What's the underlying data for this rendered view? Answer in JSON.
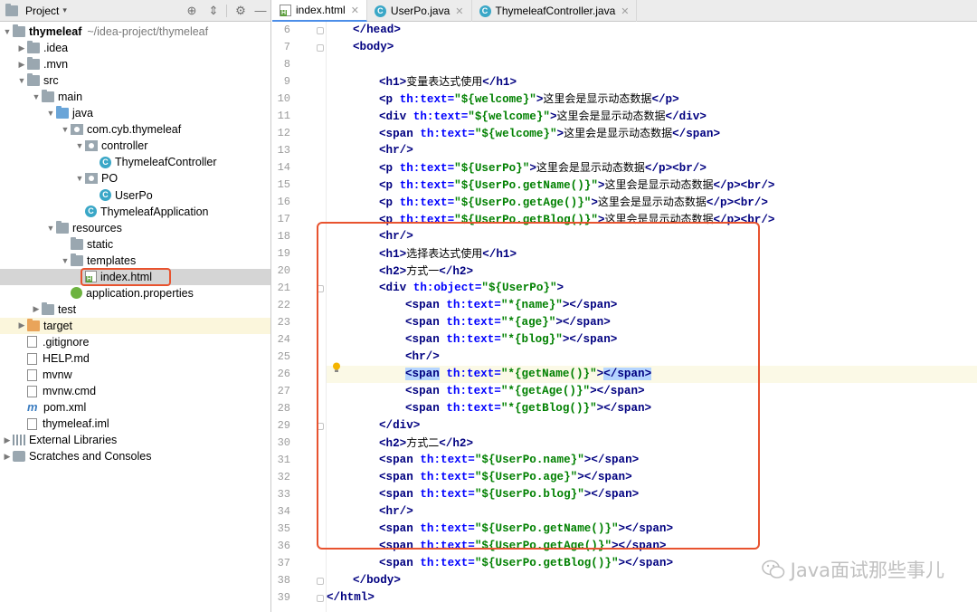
{
  "project_panel": {
    "title": "Project",
    "tree": [
      {
        "label": "thymeleaf",
        "path": "~/idea-project/thymeleaf",
        "indent": 0,
        "arrow": "down",
        "icon": "folder-icon",
        "bold": true
      },
      {
        "label": ".idea",
        "indent": 1,
        "arrow": "right",
        "icon": "folder-icon"
      },
      {
        "label": ".mvn",
        "indent": 1,
        "arrow": "right",
        "icon": "folder-icon"
      },
      {
        "label": "src",
        "indent": 1,
        "arrow": "down",
        "icon": "folder-icon"
      },
      {
        "label": "main",
        "indent": 2,
        "arrow": "down",
        "icon": "folder-icon"
      },
      {
        "label": "java",
        "indent": 3,
        "arrow": "down",
        "icon": "source-folder-icon"
      },
      {
        "label": "com.cyb.thymeleaf",
        "indent": 4,
        "arrow": "down",
        "icon": "package-icon"
      },
      {
        "label": "controller",
        "indent": 5,
        "arrow": "down",
        "icon": "package-icon"
      },
      {
        "label": "ThymeleafController",
        "indent": 6,
        "arrow": "",
        "icon": "class-icon"
      },
      {
        "label": "PO",
        "indent": 5,
        "arrow": "down",
        "icon": "package-icon"
      },
      {
        "label": "UserPo",
        "indent": 6,
        "arrow": "",
        "icon": "class-icon"
      },
      {
        "label": "ThymeleafApplication",
        "indent": 5,
        "arrow": "",
        "icon": "spring-class-icon"
      },
      {
        "label": "resources",
        "indent": 3,
        "arrow": "down",
        "icon": "resources-folder-icon"
      },
      {
        "label": "static",
        "indent": 4,
        "arrow": "",
        "icon": "folder-icon"
      },
      {
        "label": "templates",
        "indent": 4,
        "arrow": "down",
        "icon": "folder-icon"
      },
      {
        "label": "index.html",
        "indent": 5,
        "arrow": "",
        "icon": "html-file-icon",
        "selected": true
      },
      {
        "label": "application.properties",
        "indent": 4,
        "arrow": "",
        "icon": "properties-file-icon"
      },
      {
        "label": "test",
        "indent": 2,
        "arrow": "right",
        "icon": "folder-icon"
      },
      {
        "label": "target",
        "indent": 1,
        "arrow": "right",
        "icon": "excluded-folder-icon",
        "highlight": true
      },
      {
        "label": ".gitignore",
        "indent": 1,
        "arrow": "",
        "icon": "gitignore-file-icon"
      },
      {
        "label": "HELP.md",
        "indent": 1,
        "arrow": "",
        "icon": "markdown-file-icon"
      },
      {
        "label": "mvnw",
        "indent": 1,
        "arrow": "",
        "icon": "script-file-icon"
      },
      {
        "label": "mvnw.cmd",
        "indent": 1,
        "arrow": "",
        "icon": "text-file-icon"
      },
      {
        "label": "pom.xml",
        "indent": 1,
        "arrow": "",
        "icon": "maven-icon"
      },
      {
        "label": "thymeleaf.iml",
        "indent": 1,
        "arrow": "",
        "icon": "iml-file-icon"
      },
      {
        "label": "External Libraries",
        "indent": 0,
        "arrow": "right",
        "icon": "libraries-icon"
      },
      {
        "label": "Scratches and Consoles",
        "indent": 0,
        "arrow": "right",
        "icon": "scratches-icon"
      }
    ]
  },
  "editor": {
    "tabs": [
      {
        "label": "index.html",
        "icon": "html-file-icon",
        "active": true
      },
      {
        "label": "UserPo.java",
        "icon": "class-icon",
        "active": false
      },
      {
        "label": "ThymeleafController.java",
        "icon": "class-icon",
        "active": false
      }
    ],
    "current_line": 26,
    "lines": [
      {
        "n": "6",
        "indent": 1,
        "tokens": [
          [
            "tag",
            "</head>"
          ]
        ]
      },
      {
        "n": "7",
        "indent": 1,
        "tokens": [
          [
            "tag",
            "<body>"
          ]
        ]
      },
      {
        "n": "8",
        "indent": 0,
        "tokens": []
      },
      {
        "n": "9",
        "indent": 2,
        "tokens": [
          [
            "tag",
            "<h1>"
          ],
          [
            "cn",
            "变量表达式使用"
          ],
          [
            "tag",
            "</h1>"
          ]
        ]
      },
      {
        "n": "10",
        "indent": 2,
        "tokens": [
          [
            "tag",
            "<p "
          ],
          [
            "attr",
            "th:text="
          ],
          [
            "str",
            "\""
          ],
          [
            "strx",
            "${welcome}"
          ],
          [
            "str",
            "\""
          ],
          [
            "tag",
            ">"
          ],
          [
            "cn",
            "这里会是显示动态数据"
          ],
          [
            "tag",
            "</p>"
          ]
        ]
      },
      {
        "n": "11",
        "indent": 2,
        "tokens": [
          [
            "tag",
            "<div "
          ],
          [
            "attr",
            "th:text="
          ],
          [
            "str",
            "\""
          ],
          [
            "strx",
            "${welcome}"
          ],
          [
            "str",
            "\""
          ],
          [
            "tag",
            ">"
          ],
          [
            "cn",
            "这里会是显示动态数据"
          ],
          [
            "tag",
            "</div>"
          ]
        ]
      },
      {
        "n": "12",
        "indent": 2,
        "tokens": [
          [
            "tag",
            "<span "
          ],
          [
            "attr",
            "th:text="
          ],
          [
            "str",
            "\""
          ],
          [
            "strx",
            "${welcome}"
          ],
          [
            "str",
            "\""
          ],
          [
            "tag",
            ">"
          ],
          [
            "cn",
            "这里会是显示动态数据"
          ],
          [
            "tag",
            "</span>"
          ]
        ]
      },
      {
        "n": "13",
        "indent": 2,
        "tokens": [
          [
            "tag",
            "<hr/>"
          ]
        ]
      },
      {
        "n": "14",
        "indent": 2,
        "tokens": [
          [
            "tag",
            "<p "
          ],
          [
            "attr",
            "th:text="
          ],
          [
            "str",
            "\""
          ],
          [
            "strx",
            "${UserPo}"
          ],
          [
            "str",
            "\""
          ],
          [
            "tag",
            ">"
          ],
          [
            "cn",
            "这里会是显示动态数据"
          ],
          [
            "tag",
            "</p><br/>"
          ]
        ]
      },
      {
        "n": "15",
        "indent": 2,
        "tokens": [
          [
            "tag",
            "<p "
          ],
          [
            "attr",
            "th:text="
          ],
          [
            "str",
            "\""
          ],
          [
            "strx",
            "${UserPo.getName()}"
          ],
          [
            "str",
            "\""
          ],
          [
            "tag",
            ">"
          ],
          [
            "cn",
            "这里会是显示动态数据"
          ],
          [
            "tag",
            "</p><br/>"
          ]
        ]
      },
      {
        "n": "16",
        "indent": 2,
        "tokens": [
          [
            "tag",
            "<p "
          ],
          [
            "attr",
            "th:text="
          ],
          [
            "str",
            "\""
          ],
          [
            "strx",
            "${UserPo.getAge()}"
          ],
          [
            "str",
            "\""
          ],
          [
            "tag",
            ">"
          ],
          [
            "cn",
            "这里会是显示动态数据"
          ],
          [
            "tag",
            "</p><br/>"
          ]
        ]
      },
      {
        "n": "17",
        "indent": 2,
        "tokens": [
          [
            "tag",
            "<p "
          ],
          [
            "attr",
            "th:text="
          ],
          [
            "str",
            "\""
          ],
          [
            "strx",
            "${UserPo.getBlog()}"
          ],
          [
            "str",
            "\""
          ],
          [
            "tag",
            ">"
          ],
          [
            "cn",
            "这里会是显示动态数据"
          ],
          [
            "tag",
            "</p><br/>"
          ]
        ]
      },
      {
        "n": "18",
        "indent": 2,
        "tokens": [
          [
            "tag",
            "<hr/>"
          ]
        ]
      },
      {
        "n": "19",
        "indent": 2,
        "tokens": [
          [
            "tag",
            "<h1>"
          ],
          [
            "cn",
            "选择表达式使用"
          ],
          [
            "tag",
            "</h1>"
          ]
        ]
      },
      {
        "n": "20",
        "indent": 2,
        "tokens": [
          [
            "tag",
            "<h2>"
          ],
          [
            "cn",
            "方式一"
          ],
          [
            "tag",
            "</h2>"
          ]
        ]
      },
      {
        "n": "21",
        "indent": 2,
        "tokens": [
          [
            "tag",
            "<div "
          ],
          [
            "attr",
            "th:object="
          ],
          [
            "str",
            "\""
          ],
          [
            "strx",
            "${UserPo}"
          ],
          [
            "str",
            "\""
          ],
          [
            "tag",
            ">"
          ]
        ]
      },
      {
        "n": "22",
        "indent": 3,
        "tokens": [
          [
            "tag",
            "<span "
          ],
          [
            "attr",
            "th:text="
          ],
          [
            "str",
            "\""
          ],
          [
            "strx",
            "*{name}"
          ],
          [
            "str",
            "\""
          ],
          [
            "tag",
            "></span>"
          ]
        ]
      },
      {
        "n": "23",
        "indent": 3,
        "tokens": [
          [
            "tag",
            "<span "
          ],
          [
            "attr",
            "th:text="
          ],
          [
            "str",
            "\""
          ],
          [
            "strx",
            "*{age}"
          ],
          [
            "str",
            "\""
          ],
          [
            "tag",
            "></span>"
          ]
        ]
      },
      {
        "n": "24",
        "indent": 3,
        "tokens": [
          [
            "tag",
            "<span "
          ],
          [
            "attr",
            "th:text="
          ],
          [
            "str",
            "\""
          ],
          [
            "strx",
            "*{blog}"
          ],
          [
            "str",
            "\""
          ],
          [
            "tag",
            "></span>"
          ]
        ]
      },
      {
        "n": "25",
        "indent": 3,
        "tokens": [
          [
            "tag",
            "<hr/>"
          ]
        ]
      },
      {
        "n": "26",
        "indent": 3,
        "tokens": [
          [
            "taghl",
            "<span"
          ],
          [
            "tag",
            " "
          ],
          [
            "attr",
            "th:text="
          ],
          [
            "str",
            "\""
          ],
          [
            "strx",
            "*{getName()}"
          ],
          [
            "str",
            "\""
          ],
          [
            "tag",
            ">"
          ],
          [
            "taghl",
            "</span>"
          ]
        ]
      },
      {
        "n": "27",
        "indent": 3,
        "tokens": [
          [
            "tag",
            "<span "
          ],
          [
            "attr",
            "th:text="
          ],
          [
            "str",
            "\""
          ],
          [
            "strx",
            "*{getAge()}"
          ],
          [
            "str",
            "\""
          ],
          [
            "tag",
            "></span>"
          ]
        ]
      },
      {
        "n": "28",
        "indent": 3,
        "tokens": [
          [
            "tag",
            "<span "
          ],
          [
            "attr",
            "th:text="
          ],
          [
            "str",
            "\""
          ],
          [
            "strx",
            "*{getBlog()}"
          ],
          [
            "str",
            "\""
          ],
          [
            "tag",
            "></span>"
          ]
        ]
      },
      {
        "n": "29",
        "indent": 2,
        "tokens": [
          [
            "tag",
            "</div>"
          ]
        ]
      },
      {
        "n": "30",
        "indent": 2,
        "tokens": [
          [
            "tag",
            "<h2>"
          ],
          [
            "cn",
            "方式二"
          ],
          [
            "tag",
            "</h2>"
          ]
        ]
      },
      {
        "n": "31",
        "indent": 2,
        "tokens": [
          [
            "tag",
            "<span "
          ],
          [
            "attr",
            "th:text="
          ],
          [
            "str",
            "\""
          ],
          [
            "strx",
            "${UserPo.name}"
          ],
          [
            "str",
            "\""
          ],
          [
            "tag",
            "></span>"
          ]
        ]
      },
      {
        "n": "32",
        "indent": 2,
        "tokens": [
          [
            "tag",
            "<span "
          ],
          [
            "attr",
            "th:text="
          ],
          [
            "str",
            "\""
          ],
          [
            "strx",
            "${UserPo.age}"
          ],
          [
            "str",
            "\""
          ],
          [
            "tag",
            "></span>"
          ]
        ]
      },
      {
        "n": "33",
        "indent": 2,
        "tokens": [
          [
            "tag",
            "<span "
          ],
          [
            "attr",
            "th:text="
          ],
          [
            "str",
            "\""
          ],
          [
            "strx",
            "${UserPo.blog}"
          ],
          [
            "str",
            "\""
          ],
          [
            "tag",
            "></span>"
          ]
        ]
      },
      {
        "n": "34",
        "indent": 2,
        "tokens": [
          [
            "tag",
            "<hr/>"
          ]
        ]
      },
      {
        "n": "35",
        "indent": 2,
        "tokens": [
          [
            "tag",
            "<span "
          ],
          [
            "attr",
            "th:text="
          ],
          [
            "str",
            "\""
          ],
          [
            "strx",
            "${UserPo.getName()}"
          ],
          [
            "str",
            "\""
          ],
          [
            "tag",
            "></span>"
          ]
        ]
      },
      {
        "n": "36",
        "indent": 2,
        "tokens": [
          [
            "tag",
            "<span "
          ],
          [
            "attr",
            "th:text="
          ],
          [
            "str",
            "\""
          ],
          [
            "strx",
            "${UserPo.getAge()}"
          ],
          [
            "str",
            "\""
          ],
          [
            "tag",
            "></span>"
          ]
        ]
      },
      {
        "n": "37",
        "indent": 2,
        "tokens": [
          [
            "tag",
            "<span "
          ],
          [
            "attr",
            "th:text="
          ],
          [
            "str",
            "\""
          ],
          [
            "strx",
            "${UserPo.getBlog()}"
          ],
          [
            "str",
            "\""
          ],
          [
            "tag",
            "></span>"
          ]
        ]
      },
      {
        "n": "38",
        "indent": 1,
        "tokens": [
          [
            "tag",
            "</body>"
          ]
        ]
      },
      {
        "n": "39",
        "indent": 0,
        "tokens": [
          [
            "tag",
            "</html>"
          ]
        ]
      }
    ]
  },
  "watermark": {
    "text": "Java面试那些事儿"
  },
  "colors": {
    "highlight_box": "#e8532f",
    "tag": "#000080",
    "attr": "#0000ff",
    "string": "#008000"
  }
}
